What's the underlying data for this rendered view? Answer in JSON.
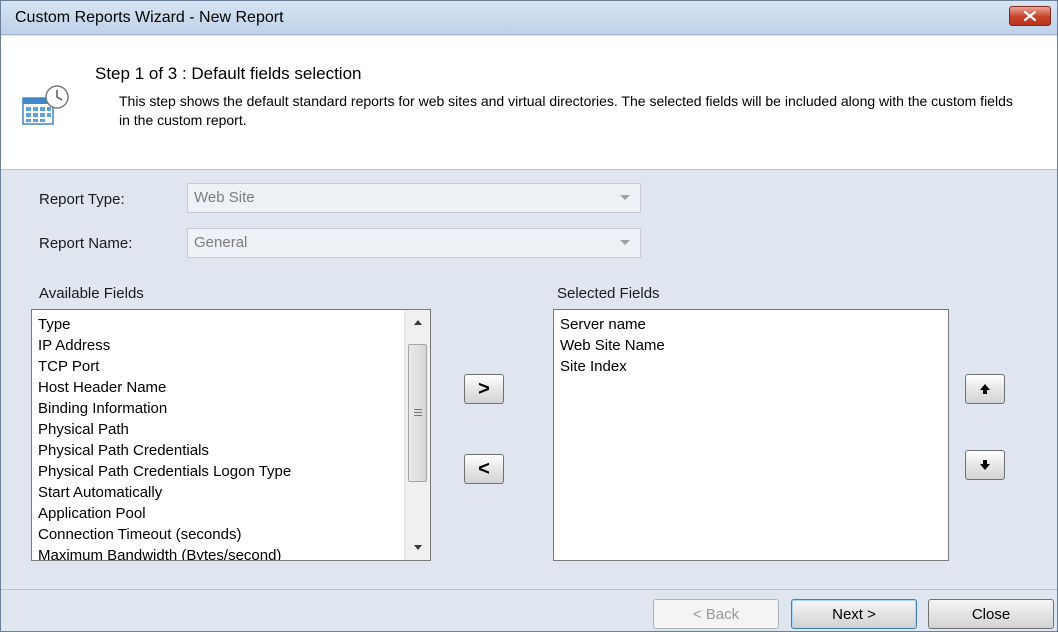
{
  "window": {
    "title": "Custom Reports Wizard - New Report"
  },
  "header": {
    "step_title": "Step 1 of 3 : Default fields selection",
    "description": "This step shows the default standard reports for web sites and virtual directories. The selected fields will be included along with the custom fields in the custom report.",
    "icon": "calendar-clock-icon"
  },
  "form": {
    "report_type_label": "Report Type:",
    "report_type_value": "Web Site",
    "report_name_label": "Report Name:",
    "report_name_value": "General"
  },
  "available": {
    "label": "Available Fields",
    "items": [
      "Type",
      "IP Address",
      "TCP Port",
      "Host Header Name",
      "Binding Information",
      "Physical Path",
      "Physical Path Credentials",
      "Physical Path Credentials Logon Type",
      "Start Automatically",
      "Application Pool",
      "Connection Timeout (seconds)",
      "Maximum Bandwidth (Bytes/second)"
    ]
  },
  "selected": {
    "label": "Selected Fields",
    "items": [
      "Server name",
      "Web Site Name",
      "Site Index"
    ]
  },
  "transfer": {
    "add_label": ">",
    "remove_label": "<",
    "move_up_icon": "arrow-up-icon",
    "move_down_icon": "arrow-down-icon"
  },
  "footer": {
    "back": "< Back",
    "next": "Next >",
    "close": "Close"
  },
  "colors": {
    "title_bar": "#c4d5ea",
    "close_button": "#c7422a",
    "content_bg": "#dfe6ef"
  }
}
